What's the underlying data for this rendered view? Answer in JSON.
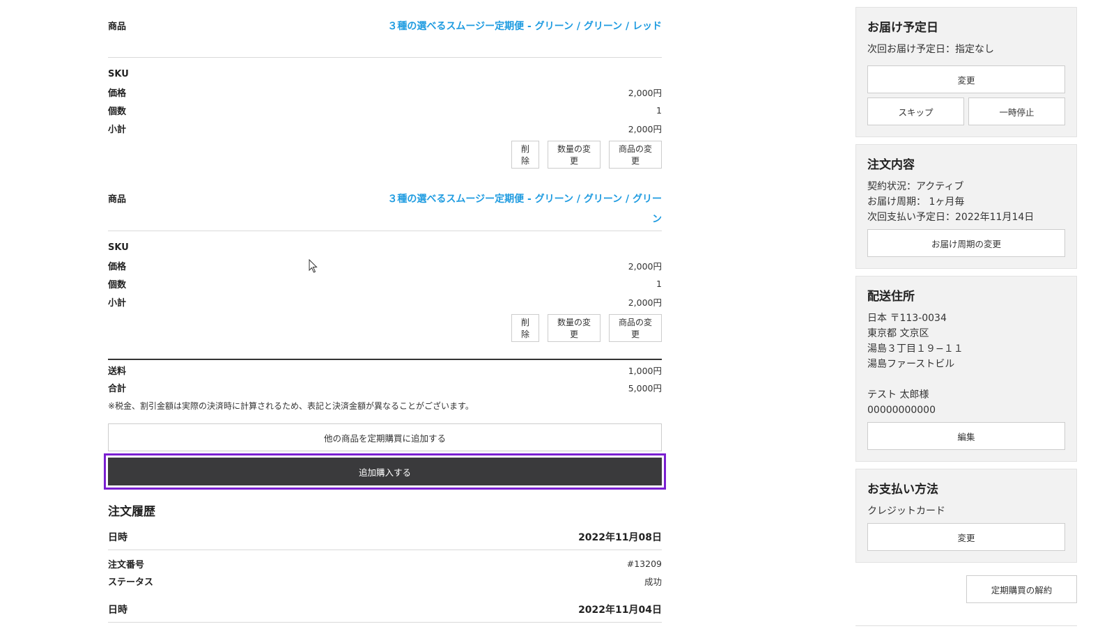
{
  "items": [
    {
      "product_label": "商品",
      "product_name": "３種の選べるスムージー定期便 - グリーン / グリーン / レッド",
      "sku_label": "SKU",
      "price_label": "価格",
      "price": "2,000円",
      "qty_label": "個数",
      "qty": "1",
      "subtotal_label": "小計",
      "subtotal": "2,000円",
      "delete_btn": "削除",
      "change_qty_btn": "数量の変更",
      "change_product_btn": "商品の変更"
    },
    {
      "product_label": "商品",
      "product_name": "３種の選べるスムージー定期便 - グリーン / グリーン / グリーン",
      "sku_label": "SKU",
      "price_label": "価格",
      "price": "2,000円",
      "qty_label": "個数",
      "qty": "1",
      "subtotal_label": "小計",
      "subtotal": "2,000円",
      "delete_btn": "削除",
      "change_qty_btn": "数量の変更",
      "change_product_btn": "商品の変更"
    }
  ],
  "totals": {
    "shipping_label": "送料",
    "shipping": "1,000円",
    "total_label": "合計",
    "total": "5,000円",
    "note": "※税金、割引金額は実際の決済時に計算されるため、表記と決済金額が異なることがございます。"
  },
  "actions": {
    "add_other": "他の商品を定期購買に追加する",
    "add_purchase": "追加購入する"
  },
  "history": {
    "title": "注文履歴",
    "date_label": "日時",
    "order_no_label": "注文番号",
    "status_label": "ステータス",
    "entries": [
      {
        "date": "2022年11月08日",
        "order_no": "#13209",
        "status": "成功"
      },
      {
        "date": "2022年11月04日"
      }
    ]
  },
  "sidebar": {
    "delivery": {
      "title": "お届け予定日",
      "next": "次回お届け予定日：指定なし",
      "change_btn": "変更",
      "skip_btn": "スキップ",
      "pause_btn": "一時停止"
    },
    "order": {
      "title": "注文内容",
      "status": "契約状況：アクティブ",
      "cycle": "お届け周期： 1ヶ月毎",
      "next_payment": "次回支払い予定日：2022年11月14日",
      "change_cycle_btn": "お届け周期の変更"
    },
    "address": {
      "title": "配送住所",
      "line1": "日本 〒113-0034",
      "line2": "東京都 文京区",
      "line3": "湯島３丁目１９−１１",
      "line4": "湯島ファーストビル",
      "name": "テスト 太郎様",
      "phone": "00000000000",
      "edit_btn": "編集"
    },
    "payment": {
      "title": "お支払い方法",
      "method": "クレジットカード",
      "change_btn": "変更"
    },
    "cancel_btn": "定期購買の解約"
  }
}
